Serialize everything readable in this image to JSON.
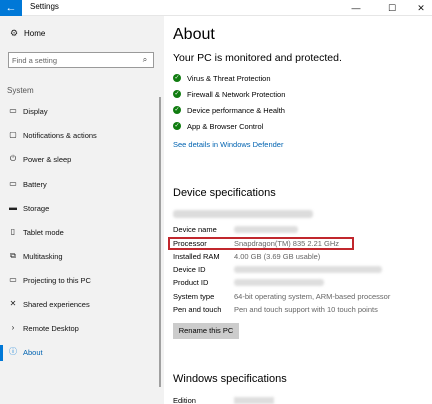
{
  "window": {
    "title": "Settings",
    "back_glyph": "←",
    "minimize_glyph": "—",
    "maximize_glyph": "☐",
    "close_glyph": "✕"
  },
  "sidebar": {
    "home_label": "Home",
    "search_placeholder": "Find a setting",
    "section_label": "System",
    "items": [
      {
        "label": "Display",
        "icon": "display-icon",
        "glyph": "▭"
      },
      {
        "label": "Notifications & actions",
        "icon": "notifications-icon",
        "glyph": "▢"
      },
      {
        "label": "Power & sleep",
        "icon": "power-icon",
        "glyph": "⏻"
      },
      {
        "label": "Battery",
        "icon": "battery-icon",
        "glyph": "▭"
      },
      {
        "label": "Storage",
        "icon": "storage-icon",
        "glyph": "▬"
      },
      {
        "label": "Tablet mode",
        "icon": "tablet-icon",
        "glyph": "▯"
      },
      {
        "label": "Multitasking",
        "icon": "multitasking-icon",
        "glyph": "⧉"
      },
      {
        "label": "Projecting to this PC",
        "icon": "projecting-icon",
        "glyph": "▭"
      },
      {
        "label": "Shared experiences",
        "icon": "shared-experiences-icon",
        "glyph": "✕"
      },
      {
        "label": "Remote Desktop",
        "icon": "remote-desktop-icon",
        "glyph": "›"
      },
      {
        "label": "About",
        "icon": "about-icon",
        "glyph": "ⓘ"
      }
    ],
    "active_index": 10
  },
  "main": {
    "title": "About",
    "protection_heading": "Your PC is monitored and protected.",
    "protection_items": [
      "Virus & Threat Protection",
      "Firewall & Network Protection",
      "Device performance & Health",
      "App & Browser Control"
    ],
    "defender_link": "See details in Windows Defender",
    "device_spec_heading": "Device specifications",
    "specs": [
      {
        "key": "Device name",
        "value": ""
      },
      {
        "key": "Processor",
        "value": "Snapdragon(TM) 835   2.21 GHz"
      },
      {
        "key": "Installed RAM",
        "value": "4.00 GB (3.69 GB usable)"
      },
      {
        "key": "Device ID",
        "value": ""
      },
      {
        "key": "Product ID",
        "value": ""
      },
      {
        "key": "System type",
        "value": "64-bit operating system, ARM-based processor"
      },
      {
        "key": "Pen and touch",
        "value": "Pen and touch support with 10 touch points"
      }
    ],
    "rename_button": "Rename this PC",
    "windows_spec_heading": "Windows specifications",
    "edition_label": "Edition"
  },
  "colors": {
    "accent": "#0078d7",
    "check_green": "#107c10",
    "highlight_red": "#c1272d",
    "sidebar_bg": "#f2f2f2"
  }
}
